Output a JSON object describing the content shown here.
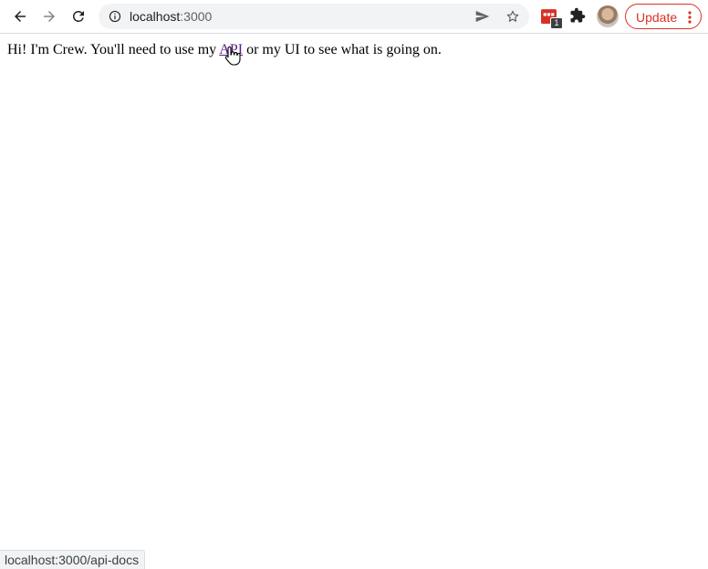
{
  "browser": {
    "url_host": "localhost",
    "url_port": ":3000",
    "extension_badge": "1",
    "update_label": "Update"
  },
  "page": {
    "text_before": "Hi! I'm Crew. You'll need to use my ",
    "api_link_label": "API",
    "text_after": " or my UI to see what is going on."
  },
  "status_bar": {
    "hover_url": "localhost:3000/api-docs"
  },
  "colors": {
    "link": "#551a8b",
    "update_accent": "#d93025",
    "omnibox_bg": "#f1f3f4",
    "extension_red": "#d93025"
  }
}
